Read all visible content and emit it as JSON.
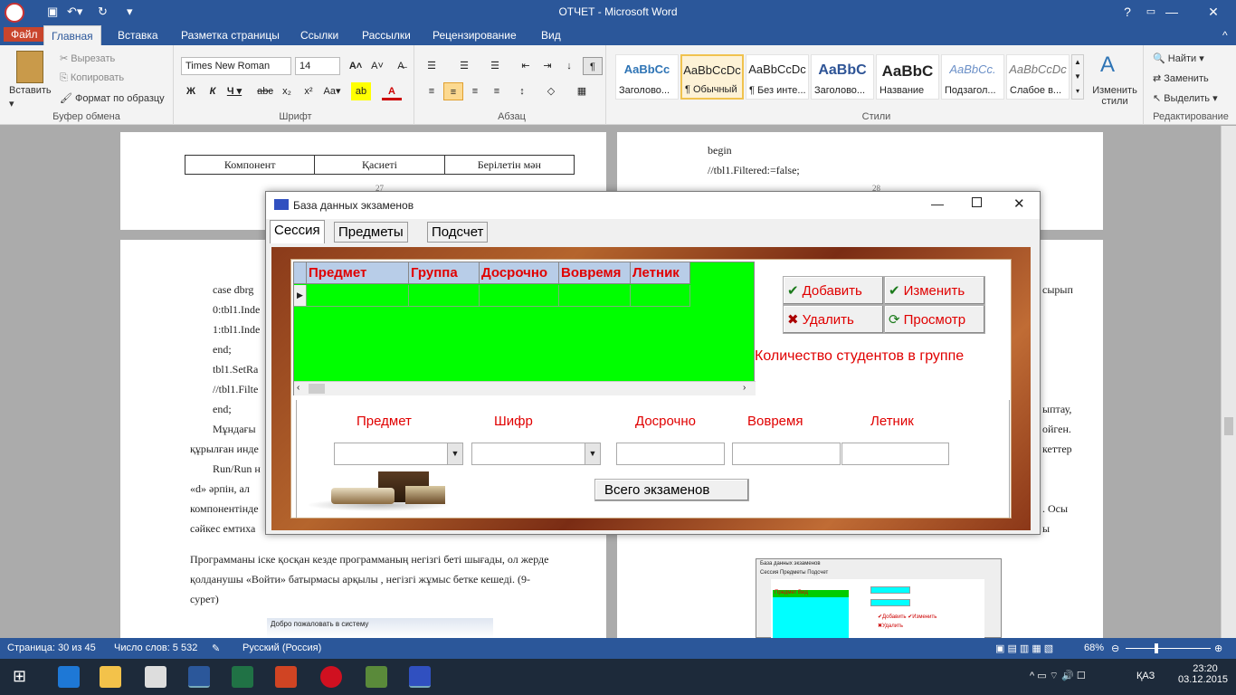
{
  "window": {
    "title": "ОТЧЕТ - Microsoft Word"
  },
  "ribbon": {
    "tabs": [
      "Файл",
      "Главная",
      "Вставка",
      "Разметка страницы",
      "Ссылки",
      "Рассылки",
      "Рецензирование",
      "Вид"
    ],
    "clipboard": {
      "paste": "Вставить",
      "cut": "Вырезать",
      "copy": "Копировать",
      "format_painter": "Формат по образцу",
      "label": "Буфер обмена"
    },
    "font": {
      "name": "Times New Roman",
      "size": "14",
      "label": "Шрифт"
    },
    "paragraph": {
      "label": "Абзац"
    },
    "styles": {
      "items": [
        {
          "preview": "AaBbCc",
          "name": "Заголово..."
        },
        {
          "preview": "AaBbCcDc",
          "name": "¶ Обычный"
        },
        {
          "preview": "AaBbCcDc",
          "name": "¶ Без инте..."
        },
        {
          "preview": "AaBbC",
          "name": "Заголово..."
        },
        {
          "preview": "AaBbC",
          "name": "Название"
        },
        {
          "preview": "AaBbCc.",
          "name": "Подзагол..."
        },
        {
          "preview": "AaBbCcDc",
          "name": "Слабое в..."
        }
      ],
      "change": "Изменить стили",
      "label": "Стили"
    },
    "editing": {
      "find": "Найти",
      "replace": "Заменить",
      "select": "Выделить",
      "label": "Редактирование"
    }
  },
  "document": {
    "left_top_table": [
      "Компонент",
      "Қасиеті",
      "Берілетін мән"
    ],
    "page_num_left": "27",
    "page_num_right": "28",
    "right_top": [
      "begin",
      "//tbl1.Filtered:=false;"
    ],
    "left_lines": [
      "case dbrg",
      "0:tbl1.Inde",
      "1:tbl1.Inde",
      "end;",
      "tbl1.SetRa",
      "//tbl1.Filte",
      "end;",
      "Мұндағы",
      "құрылған инде",
      "Run/Run н",
      "«d»  әрпін,  ал",
      "компонентінде",
      "сәйкес емтиха"
    ],
    "right_frag": [
      "сырып",
      "ыптау,",
      "ойген.",
      "кеттер",
      ". Осы",
      "ы"
    ],
    "left_bottom": [
      "Программаны іске қосқан кезде программаның негізгі беті шығады, ол жерде",
      "қолданушы  «Войти»  батырмасы  арқылы  ,  негізгі  жұмыс  бетке  кешеді.  (9-",
      "сурет)"
    ],
    "left_bottom_caption": "Добро пожаловать в систему",
    "thumb": {
      "title": "База данных экзаменов",
      "tabs": "Сессия  Предметы  Подсчет",
      "grid": "Предмет      Вид",
      "add": "Добавить",
      "edit": "Изменить",
      "del": "Удалить"
    }
  },
  "dialog": {
    "title": "База данных экзаменов",
    "tabs": [
      "Сессия",
      "Предметы",
      "Подсчет"
    ],
    "grid": {
      "columns": [
        "Предмет",
        "Группа",
        "Досрочно",
        "Вовремя",
        "Летник"
      ]
    },
    "buttons": {
      "add": "Добавить",
      "edit": "Изменить",
      "delete": "Удалить",
      "view": "Просмотр"
    },
    "students_label": "Количество студентов в группе",
    "fields": {
      "subject": "Предмет",
      "code": "Шифр",
      "early": "Досрочно",
      "ontime": "Вовремя",
      "summer": "Летник"
    },
    "total_button": "Всего экзаменов"
  },
  "status": {
    "page": "Страница: 30 из 45",
    "words": "Число слов: 5 532",
    "language": "Русский (Россия)",
    "zoom": "68%"
  },
  "tray": {
    "lang": "ҚАЗ",
    "time": "23:20",
    "date": "03.12.2015"
  }
}
